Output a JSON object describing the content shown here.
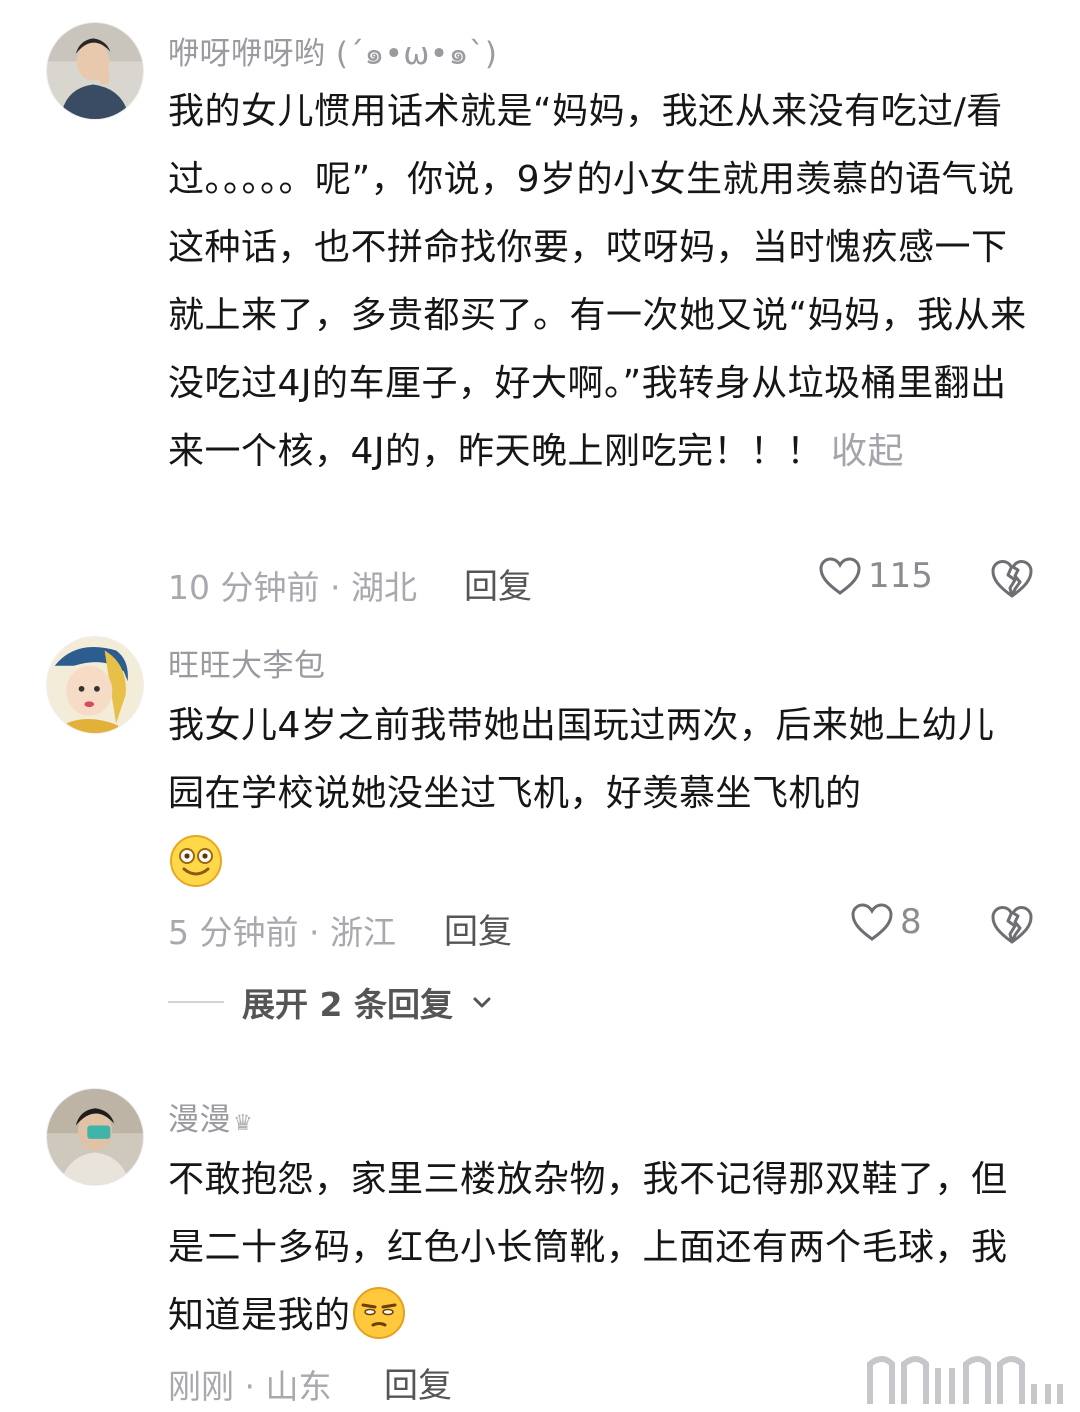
{
  "comments": [
    {
      "username": "咿呀咿呀哟 (´๑•ω•๑`)",
      "text": "我的女儿惯用话术就是“妈妈，我还从来没有吃过/看过。。。。。呢”，你说，9岁的小女生就用羡慕的语气说这种话，也不拼命找你要，哎呀妈，当时愧疚感一下就上来了，多贵都买了。有一次她又说“妈妈，我从来没吃过4J的车厘子，好大啊。”我转身从垃圾桶里翻出来一个核，4J的，昨天晚上刚吃完！！！",
      "collapse_label": "收起",
      "time": "10 分钟前 · 湖北",
      "reply_label": "回复",
      "likes": "115"
    },
    {
      "username": "旺旺大李包",
      "text": "我女儿4岁之前我带她出国玩过两次，后来她上幼儿园在学校说她没坐过飞机，好羡慕坐飞机的",
      "emoji": "dizzy-smile-emoji",
      "time": "5 分钟前 · 浙江",
      "reply_label": "回复",
      "likes": "8",
      "expand_label": "展开 2 条回复"
    },
    {
      "username": "漫漫",
      "badge": "♛",
      "text": "不敢抱怨，家里三楼放杂物，我不记得那双鞋了，但是二十多码，红色小长筒靴，上面还有两个毛球，我知道是我的",
      "emoji": "unamused-face-emoji",
      "time": "刚刚 · 山东",
      "reply_label": "回复"
    }
  ],
  "watermark": "⮥",
  "colors": {
    "meta": "#a8a8ae",
    "username": "#9a9aa0",
    "body": "#161616"
  }
}
